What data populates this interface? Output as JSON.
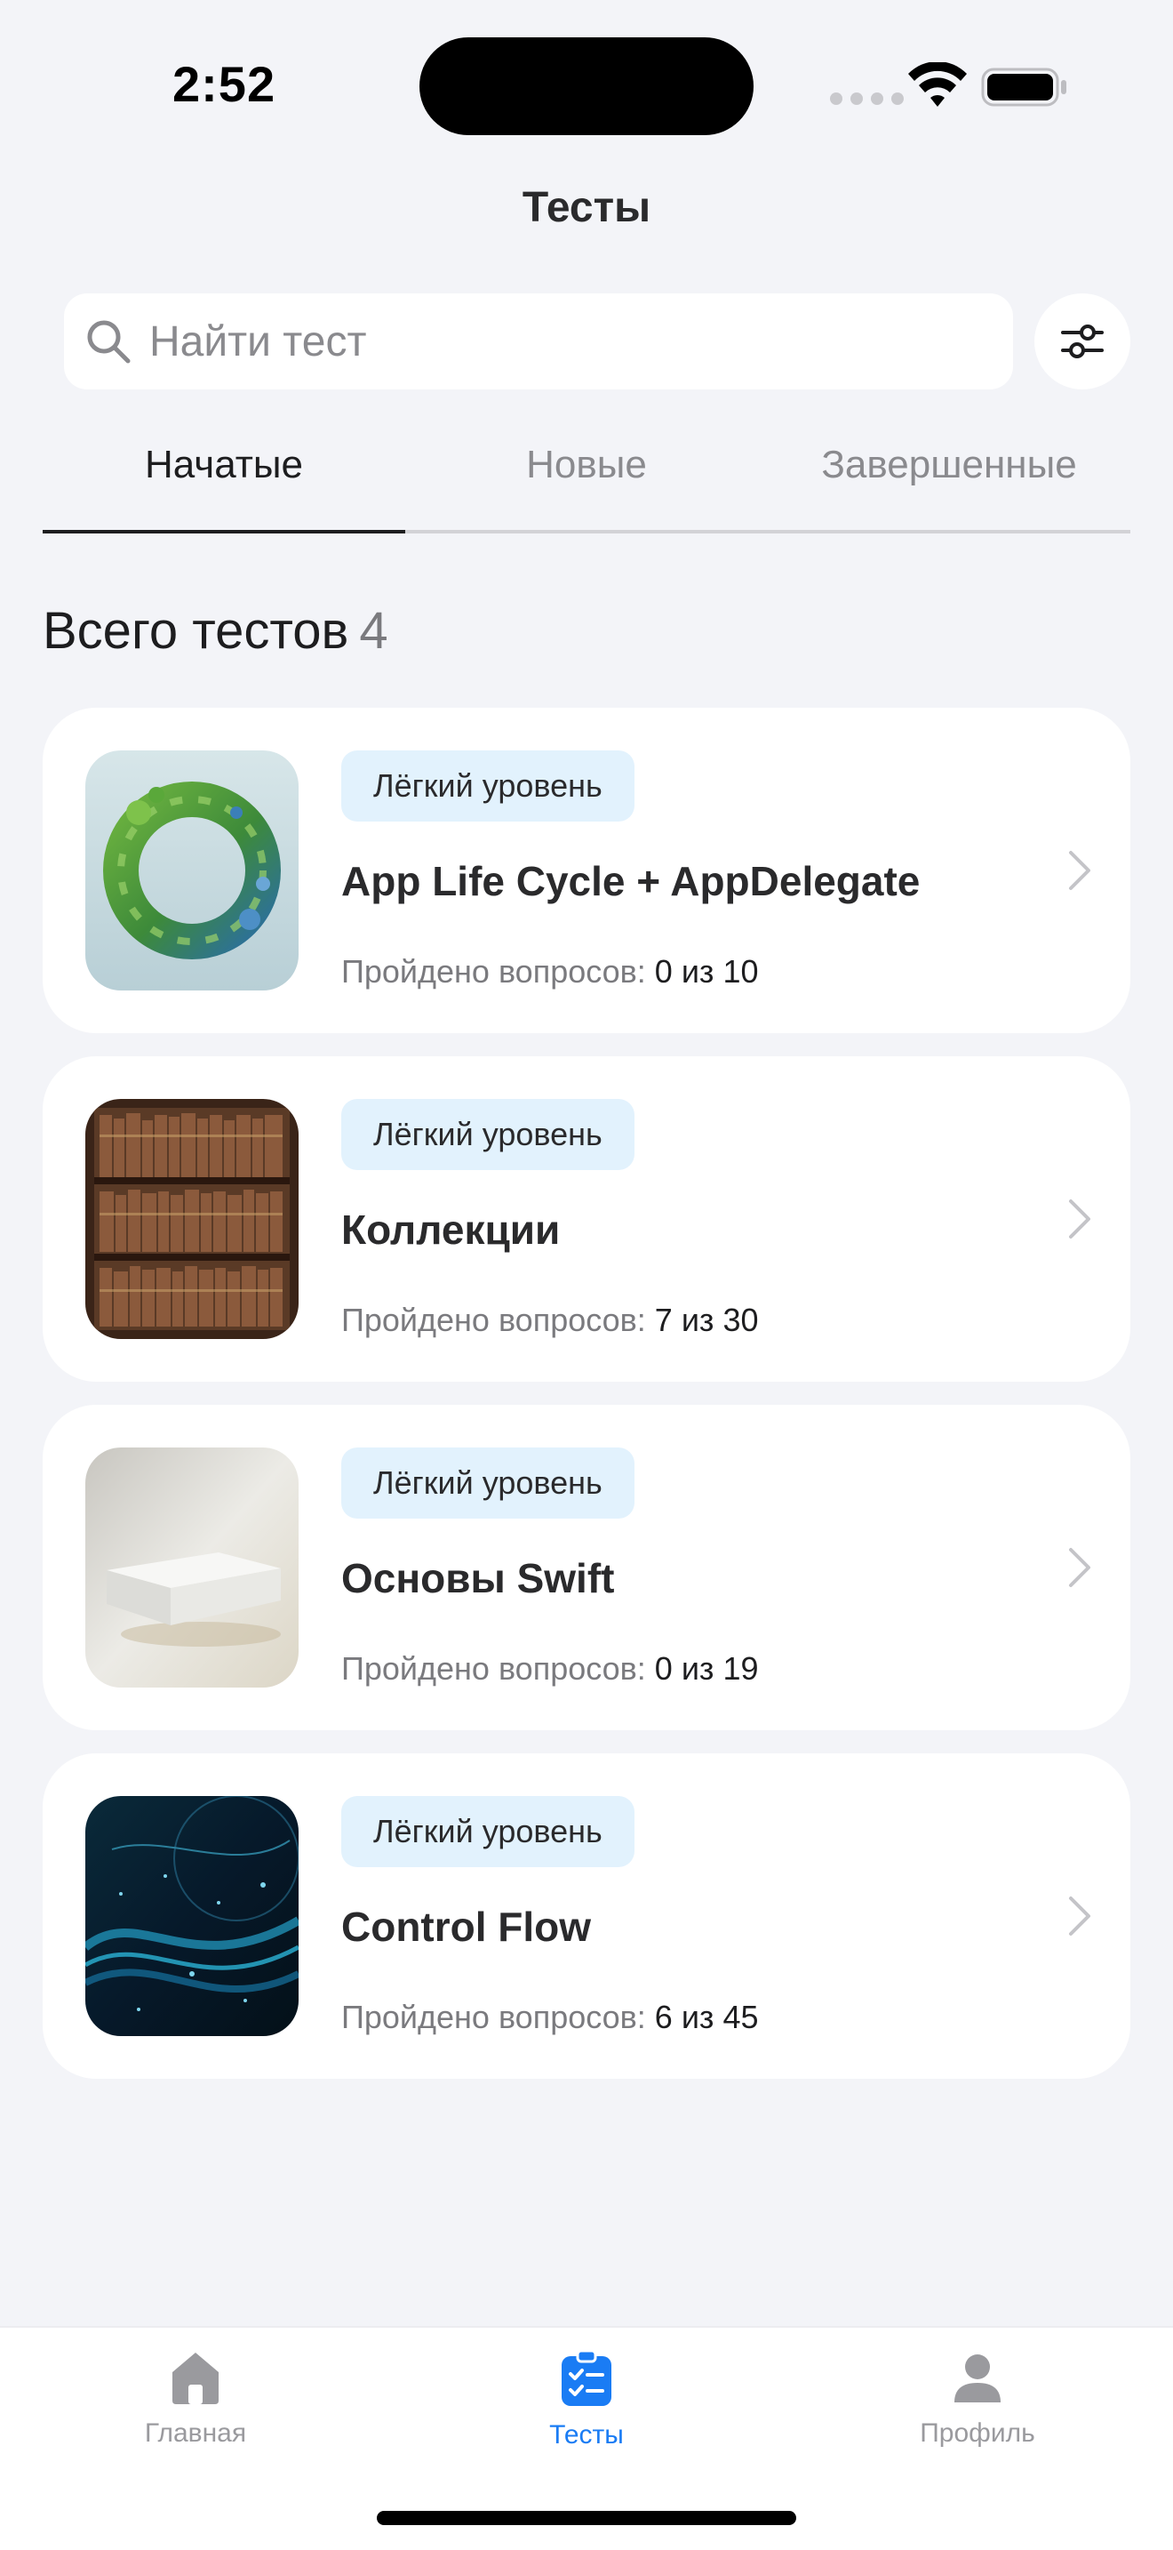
{
  "status_bar": {
    "time": "2:52"
  },
  "header": {
    "title": "Тесты"
  },
  "search": {
    "placeholder": "Найти тест",
    "value": ""
  },
  "tabs": [
    {
      "label": "Начатые",
      "active": true
    },
    {
      "label": "Новые",
      "active": false
    },
    {
      "label": "Завершенные",
      "active": false
    }
  ],
  "summary": {
    "label": "Всего тестов",
    "count": "4"
  },
  "tests": [
    {
      "level": "Лёгкий уровень",
      "title": "App Life Cycle + AppDelegate",
      "progress_label": "Пройдено вопросов:",
      "progress_value": "0 из 10",
      "image": "green-blue-abstract-ring"
    },
    {
      "level": "Лёгкий уровень",
      "title": "Коллекции",
      "progress_label": "Пройдено вопросов:",
      "progress_value": "7 из 30",
      "image": "bookshelf"
    },
    {
      "level": "Лёгкий уровень",
      "title": "Основы Swift",
      "progress_label": "Пройдено вопросов:",
      "progress_value": "0 из 19",
      "image": "floating-white-block"
    },
    {
      "level": "Лёгкий уровень",
      "title": "Control Flow",
      "progress_label": "Пройдено вопросов:",
      "progress_value": "6 из 45",
      "image": "blue-digital-waves"
    }
  ],
  "tab_bar": [
    {
      "label": "Главная",
      "icon": "home-icon",
      "active": false
    },
    {
      "label": "Тесты",
      "icon": "tests-clipboard-icon",
      "active": true
    },
    {
      "label": "Профиль",
      "icon": "profile-icon",
      "active": false
    }
  ],
  "colors": {
    "accent": "#1a7cf4",
    "badge_bg": "#e2f2fd",
    "background": "#f3f4f8"
  }
}
